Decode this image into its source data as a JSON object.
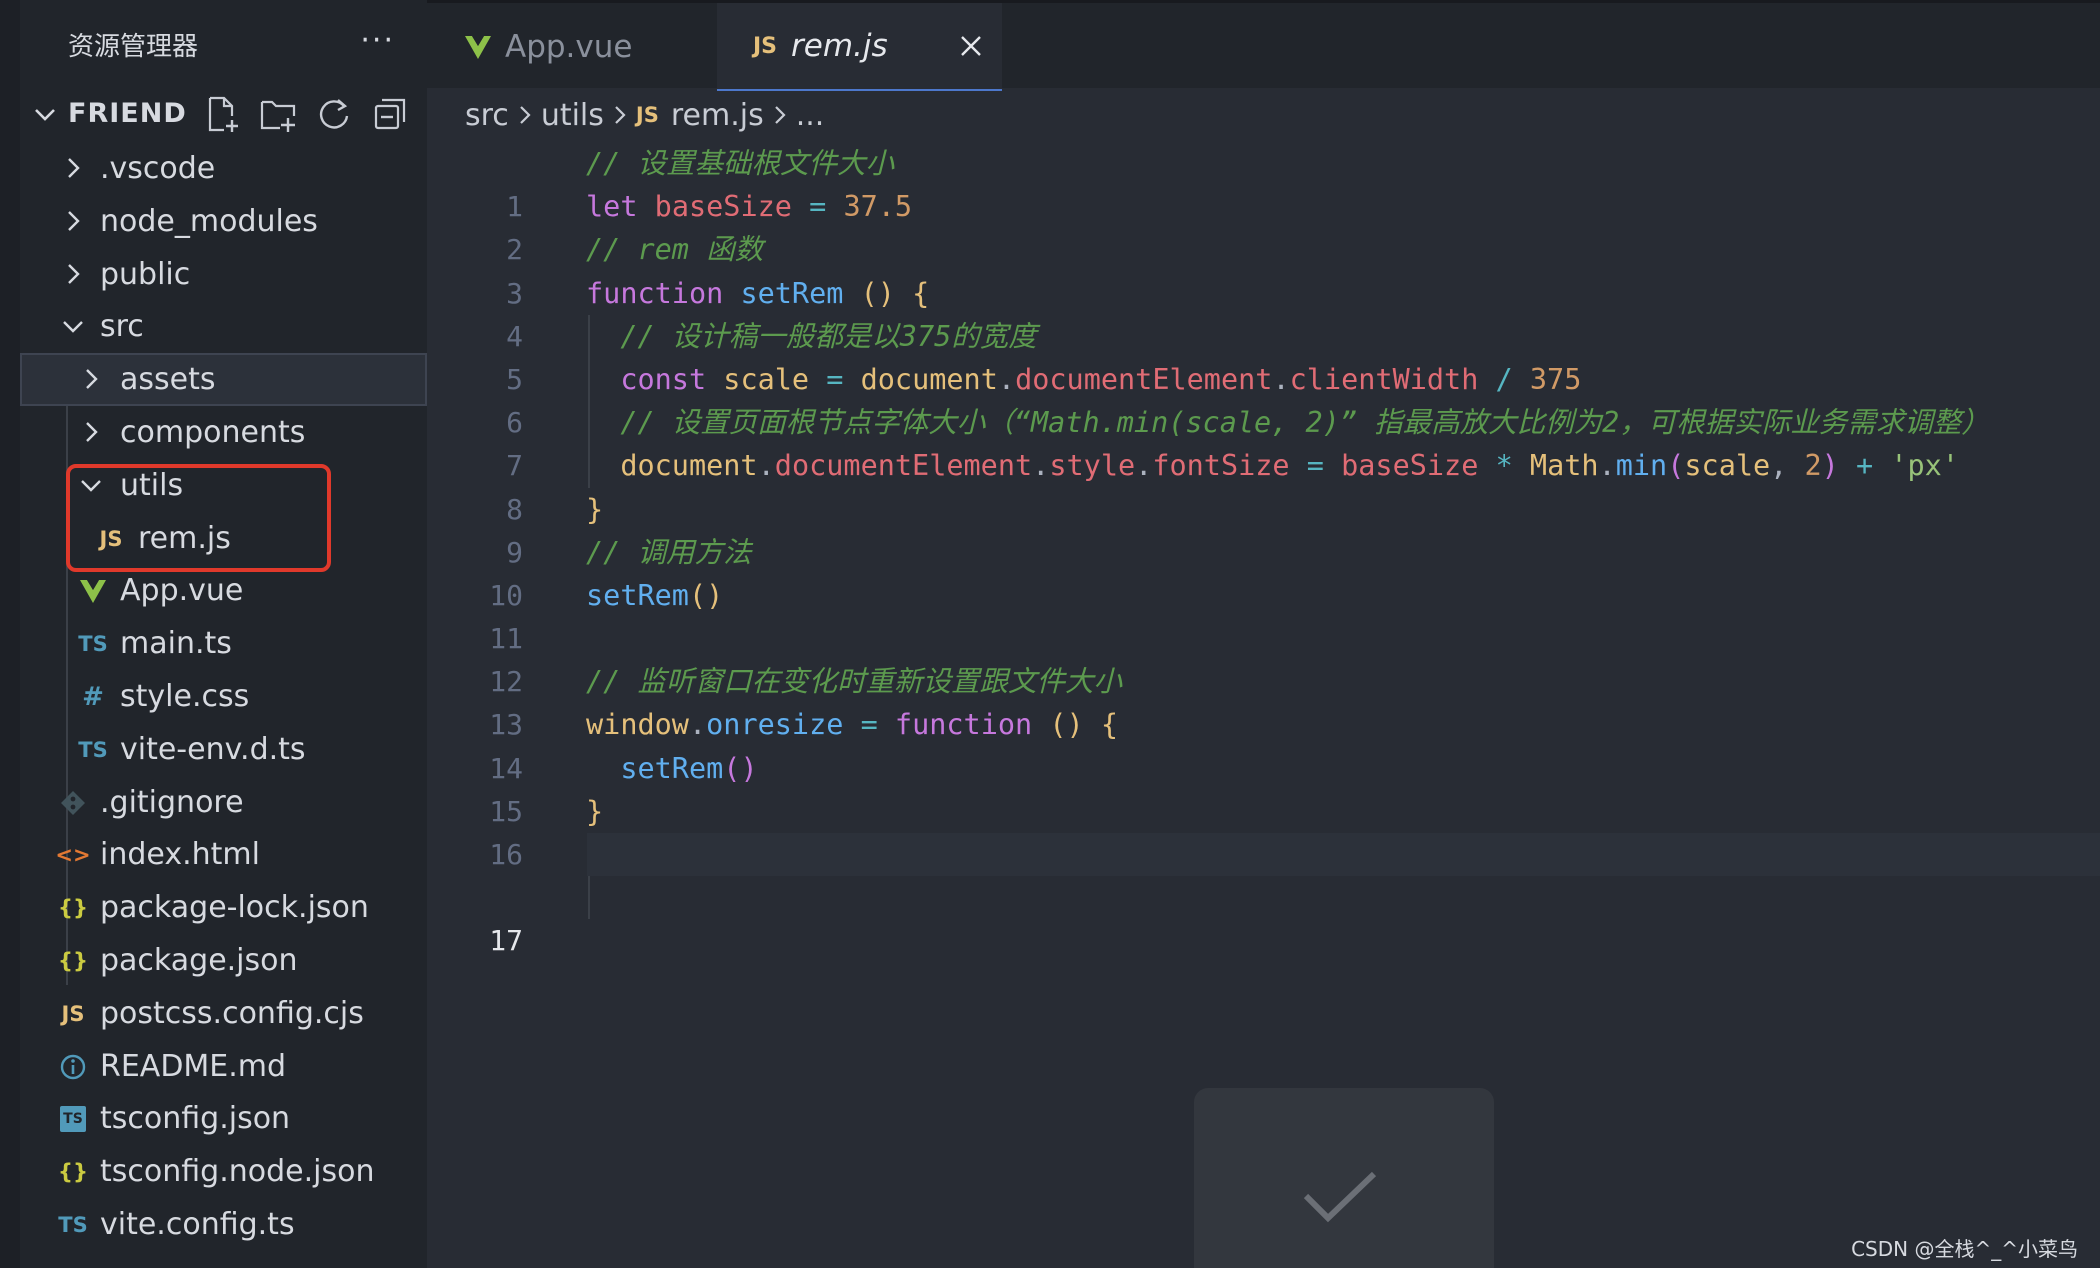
{
  "explorer": {
    "title": "资源管理器",
    "more": "···",
    "folder_name": "FRIEND"
  },
  "tree": [
    {
      "label": ".vscode",
      "icon": "chevron-right-icon"
    },
    {
      "label": "node_modules",
      "icon": "chevron-right-icon"
    },
    {
      "label": "public",
      "icon": "chevron-right-icon"
    },
    {
      "label": "src",
      "icon": "chevron-down-icon"
    },
    {
      "label": "assets",
      "icon": "chevron-right-icon"
    },
    {
      "label": "components",
      "icon": "chevron-right-icon"
    },
    {
      "label": "utils",
      "icon": "chevron-down-icon"
    },
    {
      "label": "rem.js",
      "icon": "js-file-icon",
      "badge": "JS"
    },
    {
      "label": "App.vue",
      "icon": "vue-file-icon"
    },
    {
      "label": "main.ts",
      "icon": "ts-file-icon",
      "badge": "TS"
    },
    {
      "label": "style.css",
      "icon": "css-file-icon",
      "badge": "#"
    },
    {
      "label": "vite-env.d.ts",
      "icon": "ts-file-icon",
      "badge": "TS"
    },
    {
      "label": ".gitignore",
      "icon": "git-icon"
    },
    {
      "label": "index.html",
      "icon": "html-file-icon",
      "badge": "<>"
    },
    {
      "label": "package-lock.json",
      "icon": "json-file-icon",
      "badge": "{}"
    },
    {
      "label": "package.json",
      "icon": "json-file-icon",
      "badge": "{}"
    },
    {
      "label": "postcss.config.cjs",
      "icon": "js-file-icon",
      "badge": "JS"
    },
    {
      "label": "README.md",
      "icon": "info-icon"
    },
    {
      "label": "tsconfig.json",
      "icon": "tsconfig-file-icon",
      "badge": "TS"
    },
    {
      "label": "tsconfig.node.json",
      "icon": "json-file-icon",
      "badge": "{}"
    },
    {
      "label": "vite.config.ts",
      "icon": "ts-file-icon",
      "badge": "TS"
    }
  ],
  "tabs": [
    {
      "label": "App.vue",
      "icon": "vue-file-icon",
      "active": false
    },
    {
      "label": "rem.js",
      "icon": "js-file-icon",
      "badge": "JS",
      "active": true
    }
  ],
  "breadcrumb": [
    "src",
    "utils",
    "rem.js",
    "..."
  ],
  "breadcrumb_badge": "JS",
  "code_lines": [
    "1",
    "2",
    "3",
    "4",
    "5",
    "6",
    "7",
    "8",
    "9",
    "10",
    "11",
    "12",
    "13",
    "14",
    "15",
    "16",
    "17"
  ],
  "code": {
    "l1_comment": "// 设置基础根文件大小",
    "l2_kw": "let",
    "l2_var": "baseSize",
    "l2_op": "=",
    "l2_num": "37.5",
    "l3_comment": "// rem 函数",
    "l4_kw": "function",
    "l4_fn": "setRem",
    "l4_paren": "()",
    "l4_brace": "{",
    "l5_comment": "// 设计稿一般都是以375的宽度",
    "l6_kw": "const",
    "l6_var": "scale",
    "l6_op": "=",
    "l6_obj": "document",
    "l6_prop1": "documentElement",
    "l6_prop2": "clientWidth",
    "l6_div": "/",
    "l6_num": "375",
    "l7_comment": "// 设置页面根节点字体大小（“Math.min(scale, 2)” 指最高放大比例为2，可根据实际业务需求调整）",
    "l8_obj": "document",
    "l8_prop1": "documentElement",
    "l8_prop2": "style",
    "l8_prop3": "fontSize",
    "l8_op": "=",
    "l8_var": "baseSize",
    "l8_mul": "*",
    "l8_math": "Math",
    "l8_min": "min",
    "l8_scale": "scale",
    "l8_num": "2",
    "l8_plus": "+",
    "l8_str": "'px'",
    "l9_brace": "}",
    "l10_comment": "// 调用方法",
    "l11_fn": "setRem",
    "l11_paren": "()",
    "l13_comment": "// 监听窗口在变化时重新设置跟文件大小",
    "l14_obj": "window",
    "l14_prop": "onresize",
    "l14_op": "=",
    "l14_kw": "function",
    "l14_paren": "()",
    "l14_brace": "{",
    "l15_fn": "setRem",
    "l15_paren": "()",
    "l16_brace": "}"
  },
  "watermark": "CSDN @全栈^_^小菜鸟",
  "colors": {
    "highlight_border": "#e0392b",
    "js_badge": "#e5c07b",
    "ts_badge": "#519aba",
    "vue_icon": "#8dc149"
  }
}
